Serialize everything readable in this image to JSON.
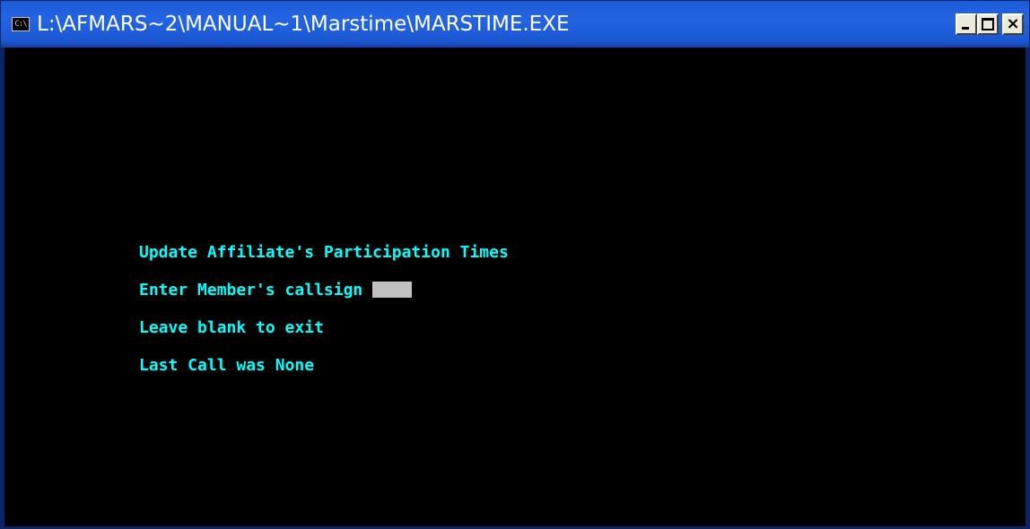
{
  "window": {
    "title": "L:\\AFMARS~2\\MANUAL~1\\Marstime\\MARSTIME.EXE",
    "icon": "C:\\",
    "controls": {
      "minimize": "minimize-icon",
      "maximize": "maximize-icon",
      "close": "close-icon"
    }
  },
  "console": {
    "heading": "Update Affiliate's Participation Times",
    "prompt_label": "Enter Member's callsign",
    "callsign_value": "",
    "hint": "Leave blank to exit",
    "last_call": "Last Call was None"
  },
  "colors": {
    "title_bar": "#2464e2",
    "console_background": "#000000",
    "console_text": "#00ffff",
    "input_field": "#c0c0c0"
  }
}
